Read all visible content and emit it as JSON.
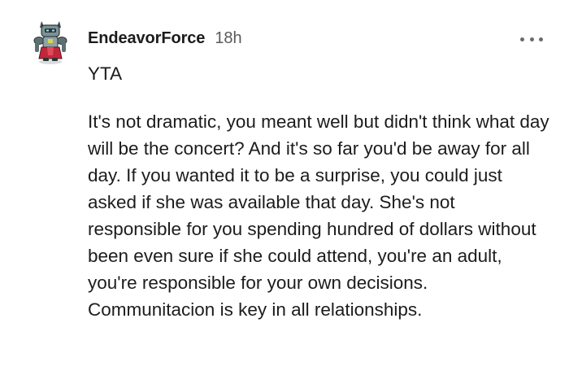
{
  "comment": {
    "username": "EndeavorForce",
    "timestamp": "18h",
    "verdict": "YTA",
    "body": "It's not dramatic, you meant well but didn't think what day will be the concert? And it's so far you'd be away for all day. If you wanted it to be a surprise, you could just asked if she was available that day. She's not responsible for you spending hundred of dollars without been even sure if she could attend, you're an adult, you're responsible for your own decisions. Communitacion is key in all relationships.",
    "avatar_icon": "robot-knight-avatar-icon",
    "more_icon": "more-options-icon"
  },
  "colors": {
    "text": "#1c1c1c",
    "muted": "#5a5a5a",
    "avatar_red": "#c0283a",
    "avatar_steel": "#6f8a8f"
  }
}
